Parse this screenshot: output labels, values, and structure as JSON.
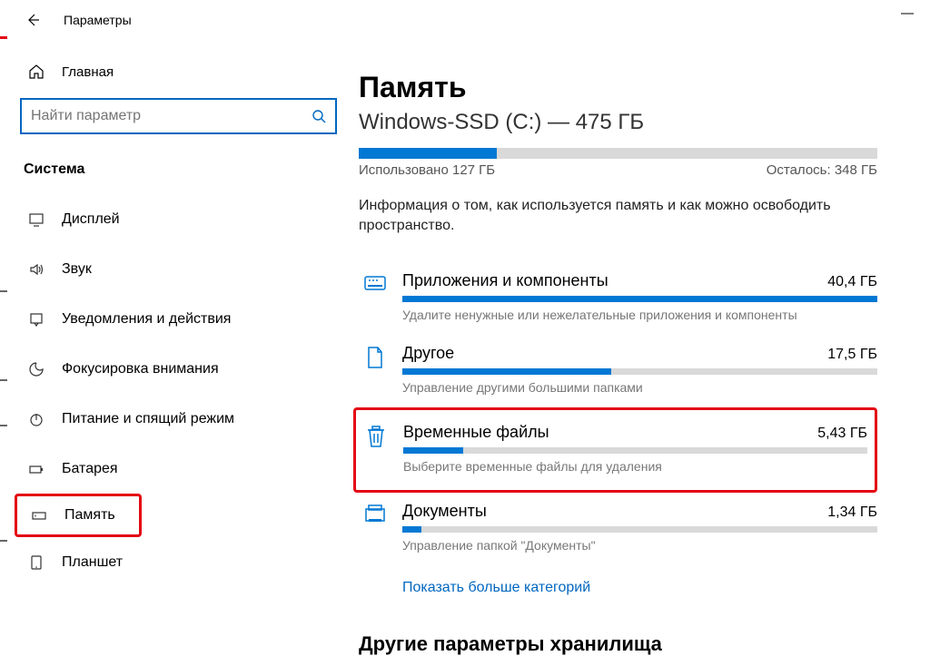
{
  "window": {
    "title": "Параметры"
  },
  "sidebar": {
    "home": "Главная",
    "search_placeholder": "Найти параметр",
    "section": "Система",
    "items": [
      {
        "label": "Дисплей",
        "icon": "display"
      },
      {
        "label": "Звук",
        "icon": "sound"
      },
      {
        "label": "Уведомления и действия",
        "icon": "notification"
      },
      {
        "label": "Фокусировка внимания",
        "icon": "focus"
      },
      {
        "label": "Питание и спящий режим",
        "icon": "power"
      },
      {
        "label": "Батарея",
        "icon": "battery"
      },
      {
        "label": "Память",
        "icon": "storage",
        "highlight": true
      },
      {
        "label": "Планшет",
        "icon": "tablet"
      }
    ]
  },
  "main": {
    "title": "Память",
    "drive": "Windows-SSD (C:) — 475 ГБ",
    "bar_percent": 26.7,
    "used_label": "Использовано 127 ГБ",
    "free_label": "Осталось: 348 ГБ",
    "description": "Информация о том, как используется память и как можно освободить пространство.",
    "categories": [
      {
        "name": "Приложения и компоненты",
        "size": "40,4 ГБ",
        "desc": "Удалите ненужные или нежелательные приложения и компоненты",
        "icon": "apps",
        "percent": 100,
        "highlight": false
      },
      {
        "name": "Другое",
        "size": "17,5 ГБ",
        "desc": "Управление другими большими папками",
        "icon": "other",
        "percent": 44,
        "highlight": false
      },
      {
        "name": "Временные файлы",
        "size": "5,43 ГБ",
        "desc": "Выберите временные файлы для удаления",
        "icon": "trash",
        "percent": 13,
        "highlight": true
      },
      {
        "name": "Документы",
        "size": "1,34 ГБ",
        "desc": "Управление папкой \"Документы\"",
        "icon": "docs",
        "percent": 4,
        "highlight": false
      }
    ],
    "show_more": "Показать больше категорий",
    "cutoff": "Другие параметры хранилища"
  }
}
